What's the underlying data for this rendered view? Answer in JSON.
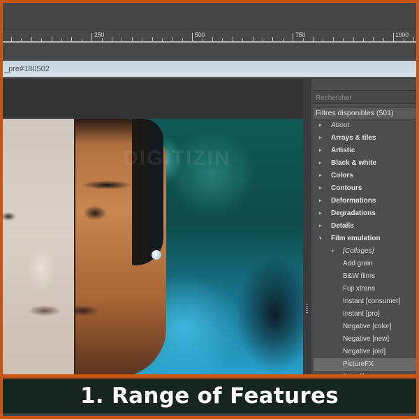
{
  "ruler": {
    "labels": [
      "250",
      "500",
      "750",
      "1000"
    ]
  },
  "document": {
    "tab_title": "_pre#180502"
  },
  "preview": {
    "watermark": "DIGITIZIN"
  },
  "filters": {
    "search_placeholder": "Rechercher",
    "header": "Filtres disponibles (501)",
    "items": [
      {
        "label": "About",
        "type": "category",
        "expanded": false,
        "italic": true
      },
      {
        "label": "Arrays & tiles",
        "type": "category",
        "expanded": false
      },
      {
        "label": "Artistic",
        "type": "category",
        "expanded": false
      },
      {
        "label": "Black & white",
        "type": "category",
        "expanded": false
      },
      {
        "label": "Colors",
        "type": "category",
        "expanded": false
      },
      {
        "label": "Contours",
        "type": "category",
        "expanded": false
      },
      {
        "label": "Deformations",
        "type": "category",
        "expanded": false
      },
      {
        "label": "Degradations",
        "type": "category",
        "expanded": false
      },
      {
        "label": "Details",
        "type": "category",
        "expanded": false
      },
      {
        "label": "Film emulation",
        "type": "category",
        "expanded": true
      },
      {
        "label": "[Collages]",
        "type": "subcategory",
        "expanded": false,
        "italic": true
      },
      {
        "label": "Add grain",
        "type": "filter"
      },
      {
        "label": "B&W films",
        "type": "filter"
      },
      {
        "label": "Fuji xtrans",
        "type": "filter"
      },
      {
        "label": "Instant [consumer]",
        "type": "filter"
      },
      {
        "label": "Instant [pro]",
        "type": "filter"
      },
      {
        "label": "Negative [color]",
        "type": "filter"
      },
      {
        "label": "Negative [new]",
        "type": "filter"
      },
      {
        "label": "Negative [old]",
        "type": "filter"
      },
      {
        "label": "PictureFX",
        "type": "filter",
        "selected": true
      },
      {
        "label": "Print films",
        "type": "filter"
      }
    ]
  },
  "icons": {
    "collapsed": "▸",
    "expanded": "▾"
  },
  "banner": {
    "title": "1. Range of Features"
  },
  "colors": {
    "border_accent": "#c9560f",
    "banner_bg": "#16251f",
    "panel_bg": "#4d4d4d"
  }
}
